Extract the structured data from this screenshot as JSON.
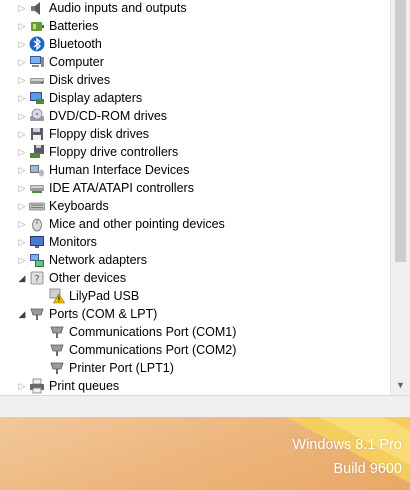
{
  "tree": {
    "items": [
      {
        "label": "Audio inputs and outputs",
        "icon": "speaker-icon",
        "expanded": false
      },
      {
        "label": "Batteries",
        "icon": "battery-icon",
        "expanded": false
      },
      {
        "label": "Bluetooth",
        "icon": "bluetooth-icon",
        "expanded": false
      },
      {
        "label": "Computer",
        "icon": "computer-icon",
        "expanded": false
      },
      {
        "label": "Disk drives",
        "icon": "disk-drive-icon",
        "expanded": false
      },
      {
        "label": "Display adapters",
        "icon": "display-adapter-icon",
        "expanded": false
      },
      {
        "label": "DVD/CD-ROM drives",
        "icon": "dvd-drive-icon",
        "expanded": false
      },
      {
        "label": "Floppy disk drives",
        "icon": "floppy-disk-icon",
        "expanded": false
      },
      {
        "label": "Floppy drive controllers",
        "icon": "floppy-controller-icon",
        "expanded": false
      },
      {
        "label": "Human Interface Devices",
        "icon": "hid-icon",
        "expanded": false
      },
      {
        "label": "IDE ATA/ATAPI controllers",
        "icon": "ide-controller-icon",
        "expanded": false
      },
      {
        "label": "Keyboards",
        "icon": "keyboard-icon",
        "expanded": false
      },
      {
        "label": "Mice and other pointing devices",
        "icon": "mouse-icon",
        "expanded": false
      },
      {
        "label": "Monitors",
        "icon": "monitor-icon",
        "expanded": false
      },
      {
        "label": "Network adapters",
        "icon": "network-adapter-icon",
        "expanded": false
      },
      {
        "label": "Other devices",
        "icon": "other-devices-icon",
        "expanded": true
      },
      {
        "label": "LilyPad USB",
        "icon": "warning-device-icon",
        "child": true
      },
      {
        "label": "Ports (COM & LPT)",
        "icon": "port-icon",
        "expanded": true
      },
      {
        "label": "Communications Port (COM1)",
        "icon": "port-icon",
        "child": true
      },
      {
        "label": "Communications Port (COM2)",
        "icon": "port-icon",
        "child": true
      },
      {
        "label": "Printer Port (LPT1)",
        "icon": "port-icon",
        "child": true
      },
      {
        "label": "Print queues",
        "icon": "printer-icon",
        "expanded": false
      }
    ]
  },
  "watermark": {
    "line1": "Windows 8.1 Pro",
    "line2": "Build 9600"
  },
  "colors": {
    "warning": "#f5c400",
    "accent": "#1e64c8"
  }
}
